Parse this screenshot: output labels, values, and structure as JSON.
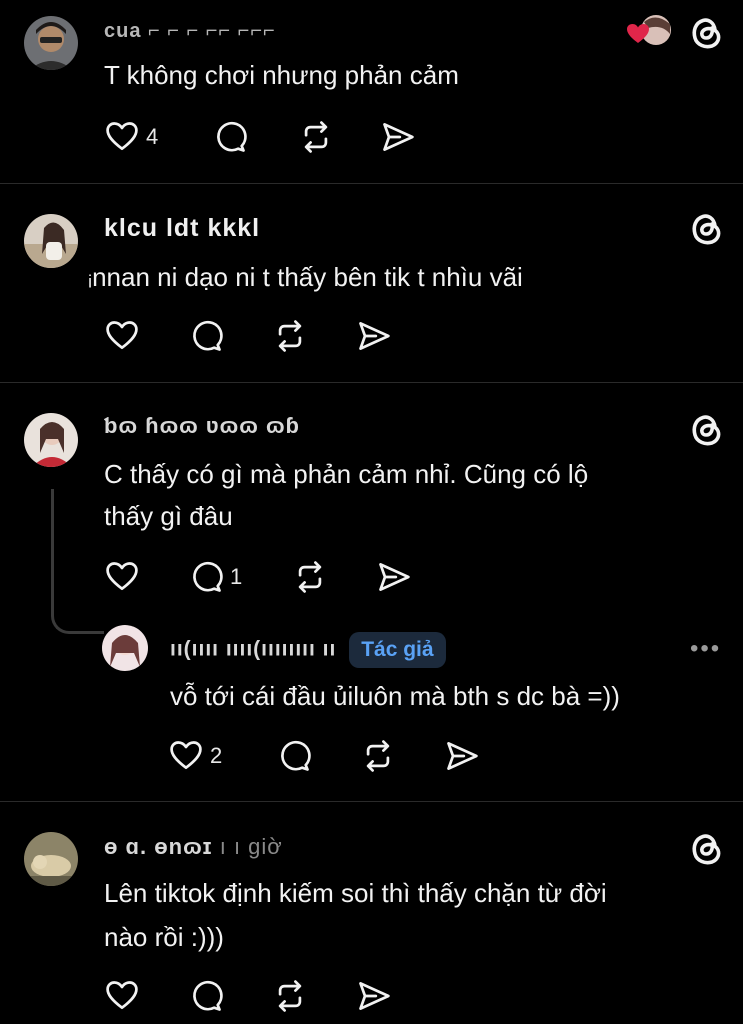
{
  "posts": [
    {
      "username": "cua  ⌐  ⌐  ⌐ ⌐⌐ ⌐⌐⌐",
      "text": "T không chơi nhưng phản cảm",
      "like_count": "4",
      "reply_count": "",
      "liked_by_author": true
    },
    {
      "username": "klcu  ldt   kkkl",
      "text": "ᵢnnan ni dạo ni t thấy bên tik t nhìu vãi",
      "like_count": "",
      "reply_count": ""
    },
    {
      "username": "ƅɷ   ɦɷɷ   ʋɷɷ   ɷɓ",
      "text_lines": [
        "C thấy có gì mà phản cảm nhỉ. Cũng có lộ",
        "thấy gì đâu"
      ],
      "like_count": "",
      "reply_count": "1"
    },
    {
      "username": "ıı(ıııı ıııı(ıııııııı ıı",
      "author_badge": "Tác giả",
      "more": "•••",
      "text": "vỗ tới cái đầu ủiluôn mà bth s dc bà =))",
      "like_count": "2",
      "reply_count": ""
    },
    {
      "username": "ɵ  ɑ.  ɵnɷɪ",
      "time": "ı ı giờ",
      "text_lines": [
        "Lên tiktok định kiếm soi thì thấy chặn từ đời",
        "nào rồi :)))"
      ],
      "like_count": "",
      "reply_count": ""
    }
  ],
  "colors": {
    "background": "#000000",
    "text": "#f2f2f2",
    "divider": "#2a2a2a",
    "badge_text": "#5aa2f5",
    "badge_bg": "#1c2a3c",
    "heart": "#e0264a"
  },
  "icons": [
    "heart-icon",
    "comment-icon",
    "repost-icon",
    "share-icon",
    "threads-icon",
    "more-icon"
  ]
}
